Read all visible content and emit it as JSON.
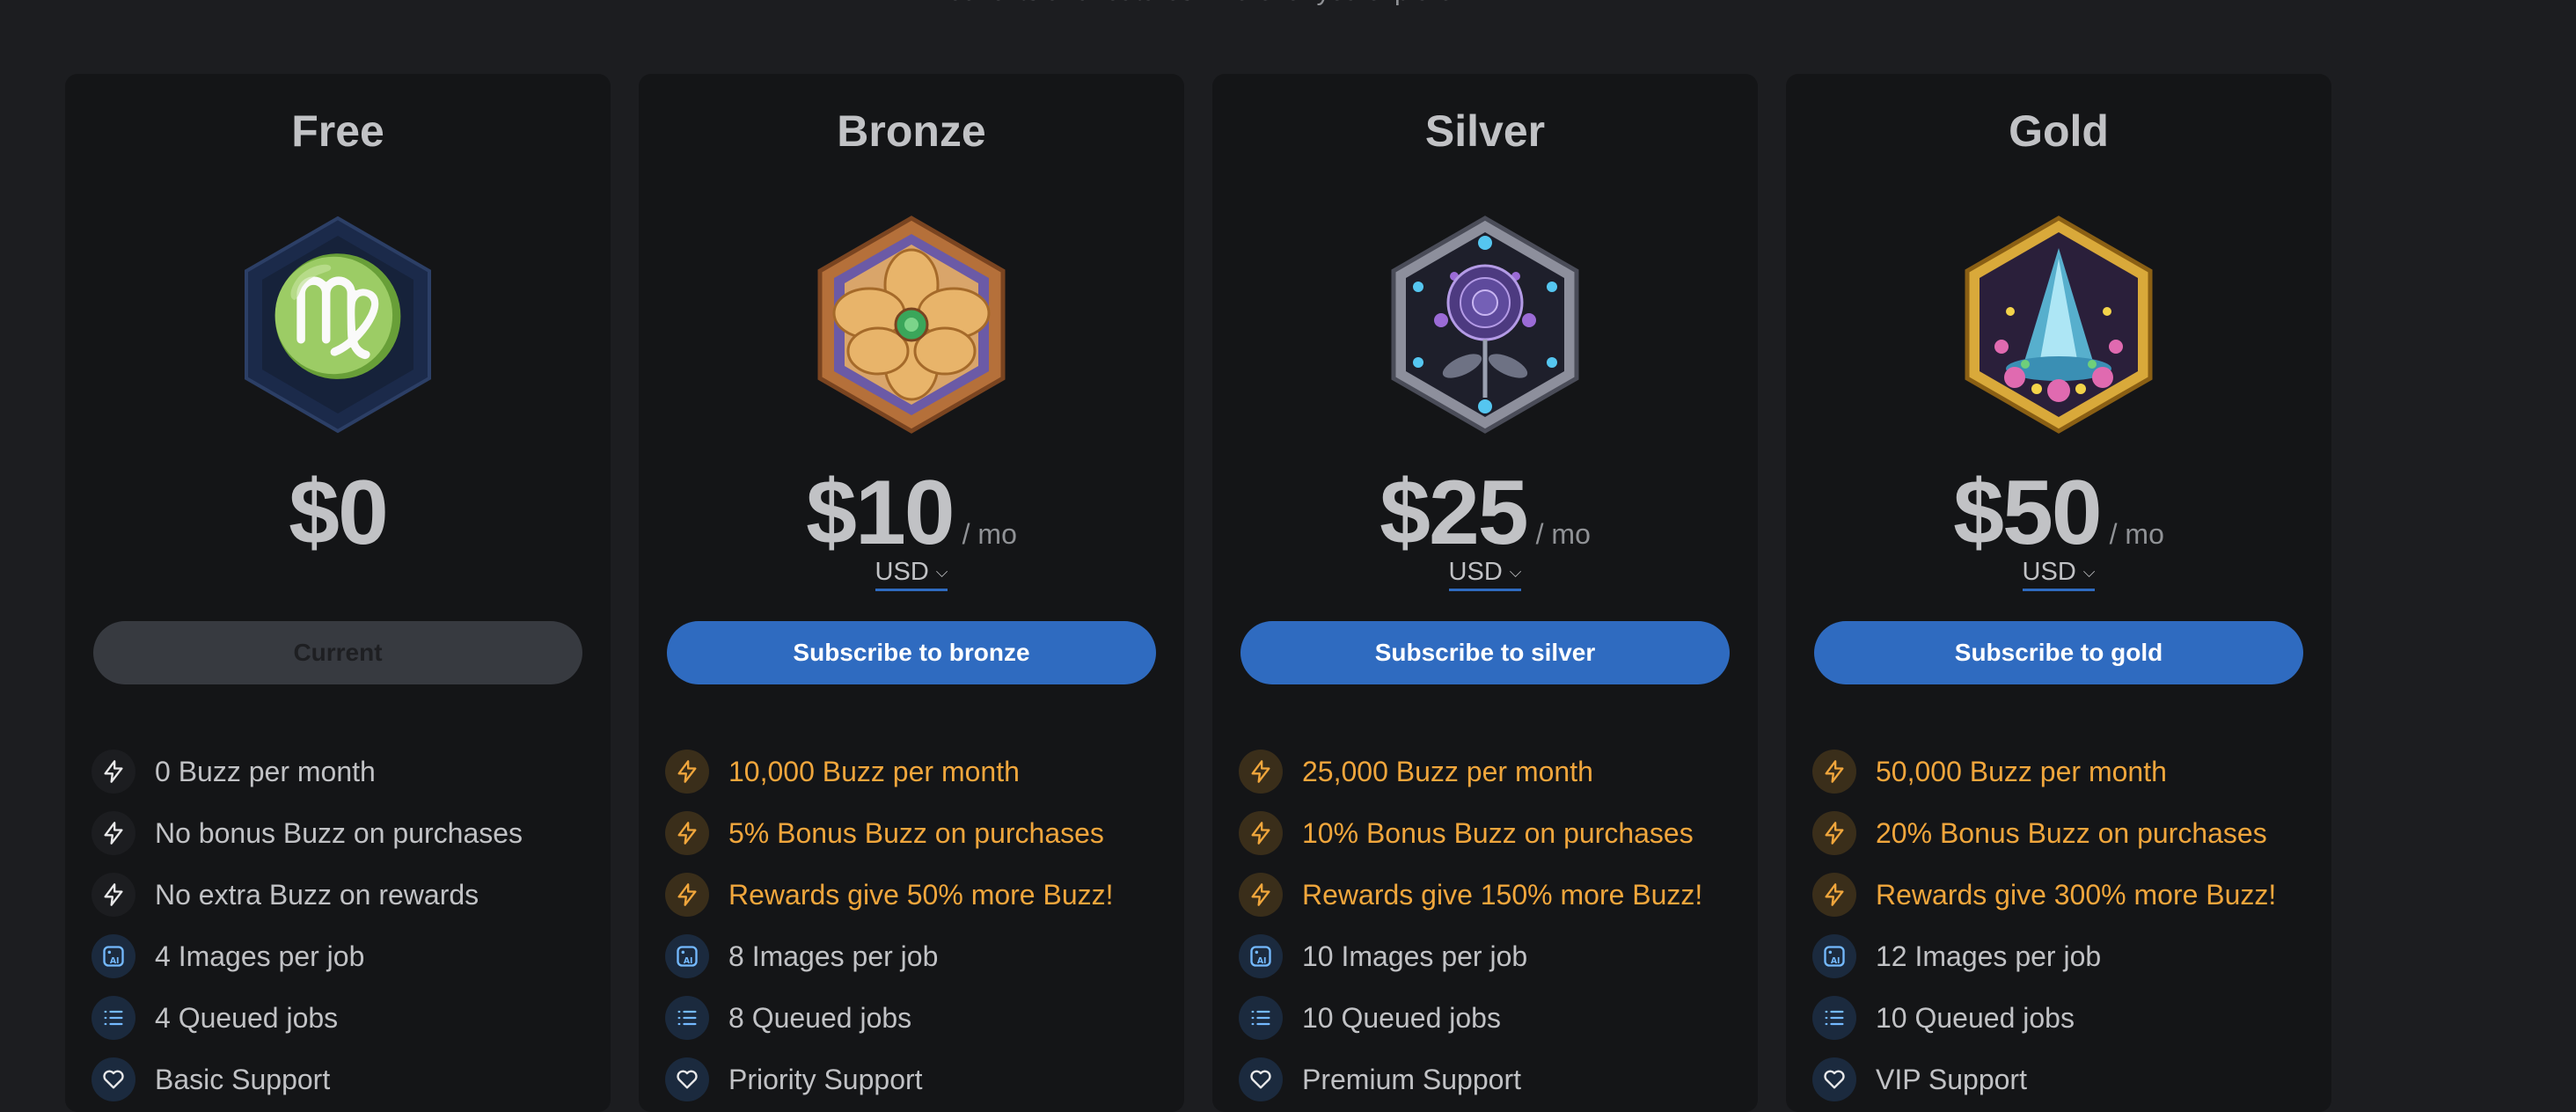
{
  "header": {
    "subtitle": "benefits and features wherever you explore"
  },
  "plans": [
    {
      "title": "Free",
      "price": "$0",
      "per": "",
      "currency": "",
      "button": "Current",
      "badge_icon": "virgo-hexagon-icon",
      "features": [
        {
          "icon": "bolt-icon",
          "text": "0 Buzz per month"
        },
        {
          "icon": "bolt-icon",
          "text": "No bonus Buzz on purchases"
        },
        {
          "icon": "bolt-icon",
          "text": "No extra Buzz on rewards"
        },
        {
          "icon": "ai-image-icon",
          "text": "4 Images per job"
        },
        {
          "icon": "list-icon",
          "text": "4 Queued jobs"
        },
        {
          "icon": "heart-icon",
          "text": "Basic Support"
        }
      ]
    },
    {
      "title": "Bronze",
      "price": "$10",
      "per": "/ mo",
      "currency": "USD",
      "button": "Subscribe to bronze",
      "badge_icon": "bronze-flower-hexagon-icon",
      "features": [
        {
          "icon": "bolt-icon",
          "text": "10,000 Buzz per month"
        },
        {
          "icon": "bolt-icon",
          "text": "5% Bonus Buzz on purchases"
        },
        {
          "icon": "bolt-icon",
          "text": "Rewards give 50% more Buzz!"
        },
        {
          "icon": "ai-image-icon",
          "text": "8 Images per job"
        },
        {
          "icon": "list-icon",
          "text": "8 Queued jobs"
        },
        {
          "icon": "heart-icon",
          "text": "Priority Support"
        }
      ]
    },
    {
      "title": "Silver",
      "price": "$25",
      "per": "/ mo",
      "currency": "USD",
      "button": "Subscribe to silver",
      "badge_icon": "silver-rose-hexagon-icon",
      "features": [
        {
          "icon": "bolt-icon",
          "text": "25,000 Buzz per month"
        },
        {
          "icon": "bolt-icon",
          "text": "10% Bonus Buzz on purchases"
        },
        {
          "icon": "bolt-icon",
          "text": "Rewards give 150% more Buzz!"
        },
        {
          "icon": "ai-image-icon",
          "text": "10 Images per job"
        },
        {
          "icon": "list-icon",
          "text": "10 Queued jobs"
        },
        {
          "icon": "heart-icon",
          "text": "Premium Support"
        }
      ]
    },
    {
      "title": "Gold",
      "price": "$50",
      "per": "/ mo",
      "currency": "USD",
      "button": "Subscribe to gold",
      "badge_icon": "gold-fountain-hexagon-icon",
      "features": [
        {
          "icon": "bolt-icon",
          "text": "50,000 Buzz per month"
        },
        {
          "icon": "bolt-icon",
          "text": "20% Bonus Buzz on purchases"
        },
        {
          "icon": "bolt-icon",
          "text": "Rewards give 300% more Buzz!"
        },
        {
          "icon": "ai-image-icon",
          "text": "12 Images per job"
        },
        {
          "icon": "list-icon",
          "text": "10 Queued jobs"
        },
        {
          "icon": "heart-icon",
          "text": "VIP Support"
        }
      ]
    }
  ],
  "colors": {
    "accent": "#2f6bc0",
    "buzz_gold": "#f0a63c",
    "card_bg": "#141517",
    "page_bg": "#1c1d20"
  }
}
